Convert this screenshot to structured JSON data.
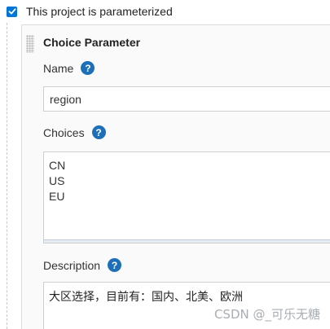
{
  "parameterized": {
    "checked": true,
    "label": "This project is parameterized"
  },
  "parameter": {
    "title": "Choice Parameter",
    "name": {
      "label": "Name",
      "help": "?",
      "value": "region"
    },
    "choices": {
      "label": "Choices",
      "help": "?",
      "items": [
        "CN",
        "US",
        "EU"
      ]
    },
    "description": {
      "label": "Description",
      "help": "?",
      "value": "大区选择，目前有：国内、北美、欧洲"
    }
  },
  "watermark": "CSDN @_可乐无糖",
  "colors": {
    "accent": "#0075d9",
    "help_icon": "#1d6fb8"
  }
}
